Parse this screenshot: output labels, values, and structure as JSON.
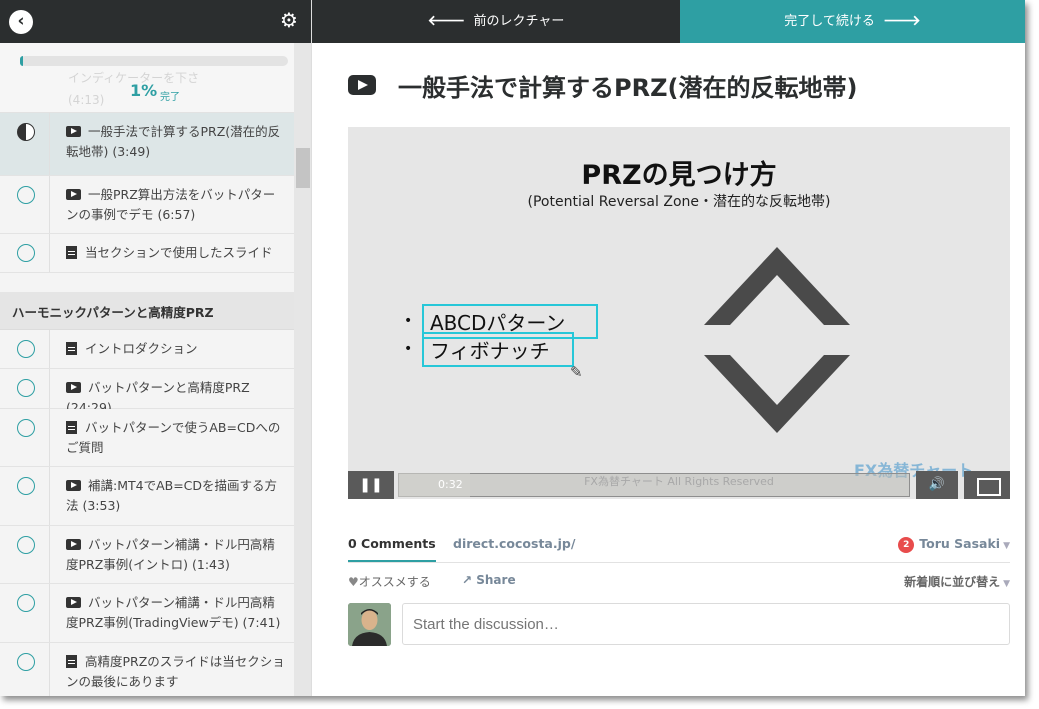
{
  "sidebar": {
    "back_icon": "chevron-left-icon",
    "settings_icon": "gear-icon",
    "ghost_text": "インディケーターを下さ",
    "ghost_text2": "(4:13)",
    "progress": {
      "percent": 1,
      "percent_text": "1%",
      "label": "完了"
    },
    "lectures_top": [
      {
        "text": "一般手法で計算するPRZ(潜在的反転地帯) (3:49)",
        "type": "video",
        "status": "in-progress"
      },
      {
        "text": "一般PRZ算出方法をバットパターンの事例でデモ (6:57)",
        "type": "video",
        "status": "not-started"
      },
      {
        "text": "当セクションで使用したスライド",
        "type": "document",
        "status": "not-started"
      }
    ],
    "section_title": "ハーモニックパターンと高精度PRZ",
    "lectures_section": [
      {
        "text": "イントロダクション",
        "type": "document"
      },
      {
        "text": "バットパターンと高精度PRZ (24:29)",
        "type": "video"
      },
      {
        "text": "バットパターンで使うAB=CDへのご質問",
        "type": "document"
      },
      {
        "text": "補講:MT4でAB=CDを描画する方法 (3:53)",
        "type": "video"
      },
      {
        "text": "バットパターン補講・ドル円高精度PRZ事例(イントロ) (1:43)",
        "type": "video"
      },
      {
        "text": "バットパターン補講・ドル円高精度PRZ事例(TradingViewデモ) (7:41)",
        "type": "video"
      },
      {
        "text": "高精度PRZのスライドは当セクションの最後にあります",
        "type": "document"
      }
    ]
  },
  "topnav": {
    "prev_label": "前のレクチャー",
    "next_label": "完了して続ける"
  },
  "lecture": {
    "title": "一般手法で計算するPRZ(潜在的反転地帯)"
  },
  "slide": {
    "title": "PRZの見つけ方",
    "subtitle": "(Potential Reversal Zone・潜在的な反転地帯)",
    "bullets": [
      "ABCDパターン",
      "フィボナッチ"
    ],
    "watermark": "FX為替チャート",
    "copyright": "FX為替チャート All Rights Reserved"
  },
  "player": {
    "time": "0:32",
    "progress_fraction": 0.14
  },
  "comments": {
    "count_label": "0 Comments",
    "site": "direct.cocosta.jp/",
    "user": "Toru Sasaki",
    "notification_count": "2",
    "recommend_label": "オススメする",
    "share_label": "Share",
    "sort_label": "新着順に並び替え",
    "placeholder": "Start the discussion…"
  },
  "colors": {
    "accent": "#2e9fa3",
    "dark": "#2b2e2f",
    "highlight": "#27c7d8"
  }
}
